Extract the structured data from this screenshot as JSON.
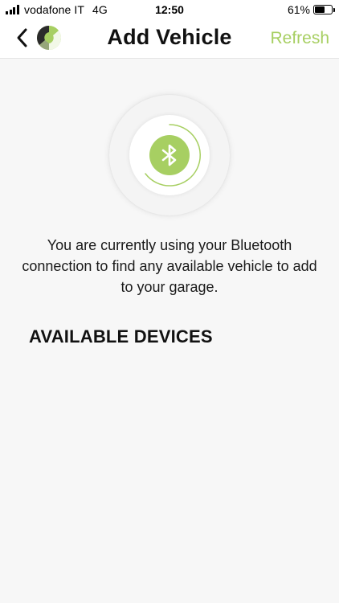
{
  "status_bar": {
    "carrier": "vodafone IT",
    "network": "4G",
    "time": "12:50",
    "battery": "61%",
    "battery_level": 0.61
  },
  "nav": {
    "title": "Add Vehicle",
    "refresh_label": "Refresh",
    "back_icon": "chevron-left-icon",
    "logo_icon": "brand-logo"
  },
  "scan": {
    "icon": "bluetooth-icon",
    "accent_color": "#a7cf62"
  },
  "info_text": "You are currently using your Bluetooth connection to find any available vehicle to add to your garage.",
  "devices": {
    "heading": "AVAILABLE DEVICES",
    "items": []
  }
}
